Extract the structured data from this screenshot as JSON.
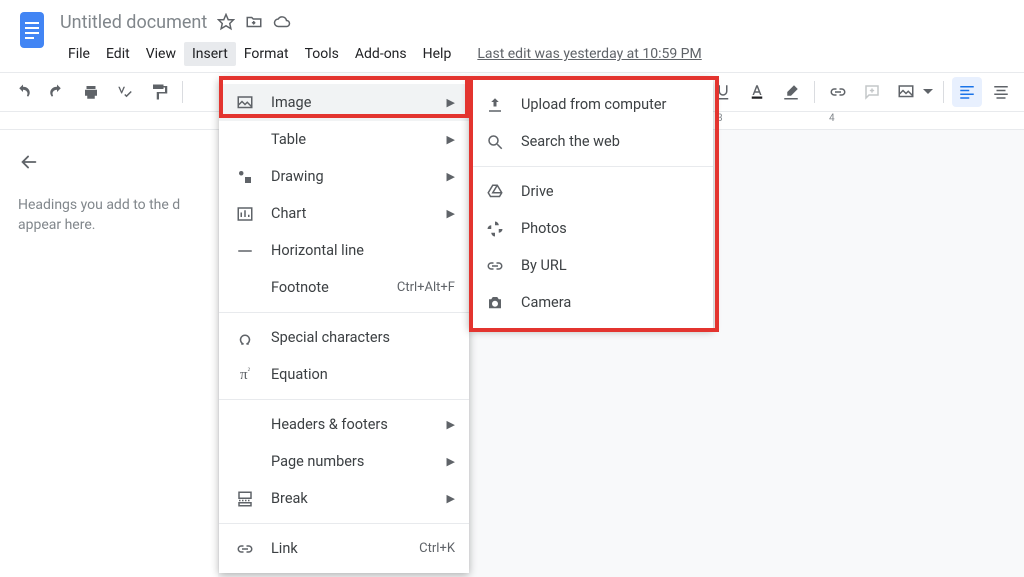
{
  "header": {
    "doc_title": "Untitled document"
  },
  "menu": {
    "file": "File",
    "edit": "Edit",
    "view": "View",
    "insert": "Insert",
    "format": "Format",
    "tools": "Tools",
    "addons": "Add-ons",
    "help": "Help",
    "last_edit": "Last edit was yesterday at 10:59 PM"
  },
  "insert_menu": {
    "image": "Image",
    "table": "Table",
    "drawing": "Drawing",
    "chart": "Chart",
    "horizontal_line": "Horizontal line",
    "footnote": "Footnote",
    "footnote_shortcut": "Ctrl+Alt+F",
    "special_chars": "Special characters",
    "equation": "Equation",
    "headers_footers": "Headers & footers",
    "page_numbers": "Page numbers",
    "break": "Break",
    "link": "Link",
    "link_shortcut": "Ctrl+K"
  },
  "image_submenu": {
    "upload": "Upload from computer",
    "search_web": "Search the web",
    "drive": "Drive",
    "photos": "Photos",
    "by_url": "By URL",
    "camera": "Camera"
  },
  "outline": {
    "empty_text": "Headings you add to the d \nappear here."
  },
  "ruler": {
    "three": "3",
    "four": "4"
  }
}
